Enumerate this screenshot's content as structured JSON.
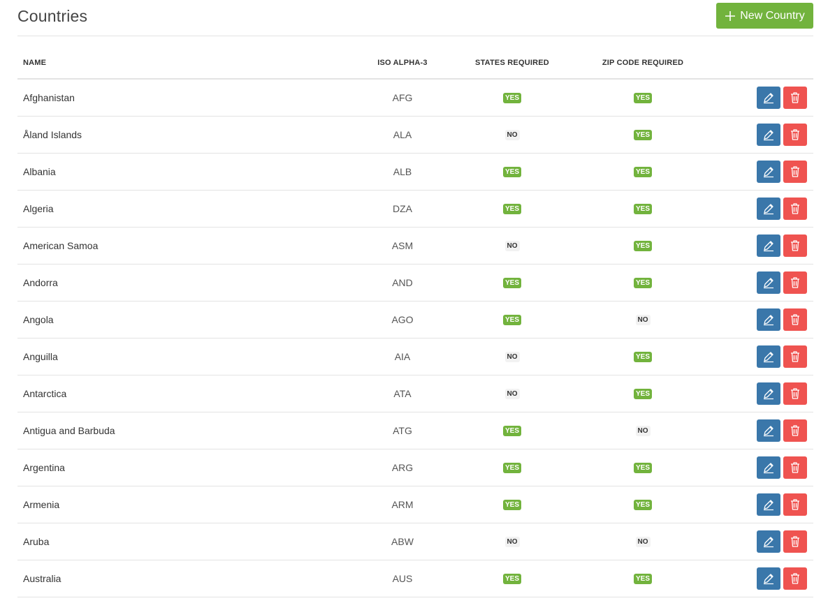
{
  "header": {
    "title": "Countries",
    "new_button_label": "New Country",
    "new_button_icon": "plus-icon"
  },
  "colors": {
    "accent_green": "#72b33d",
    "edit_blue": "#3a77aa",
    "delete_red": "#ef5350"
  },
  "table": {
    "columns": {
      "name": "NAME",
      "iso": "ISO ALPHA-3",
      "states": "STATES REQUIRED",
      "zip": "ZIP CODE REQUIRED"
    },
    "row_actions": {
      "edit_icon": "pencil-icon",
      "delete_icon": "trash-icon"
    },
    "rows": [
      {
        "name": "Afghanistan",
        "iso": "AFG",
        "states": "YES",
        "zip": "YES"
      },
      {
        "name": "Åland Islands",
        "iso": "ALA",
        "states": "NO",
        "zip": "YES"
      },
      {
        "name": "Albania",
        "iso": "ALB",
        "states": "YES",
        "zip": "YES"
      },
      {
        "name": "Algeria",
        "iso": "DZA",
        "states": "YES",
        "zip": "YES"
      },
      {
        "name": "American Samoa",
        "iso": "ASM",
        "states": "NO",
        "zip": "YES"
      },
      {
        "name": "Andorra",
        "iso": "AND",
        "states": "YES",
        "zip": "YES"
      },
      {
        "name": "Angola",
        "iso": "AGO",
        "states": "YES",
        "zip": "NO"
      },
      {
        "name": "Anguilla",
        "iso": "AIA",
        "states": "NO",
        "zip": "YES"
      },
      {
        "name": "Antarctica",
        "iso": "ATA",
        "states": "NO",
        "zip": "YES"
      },
      {
        "name": "Antigua and Barbuda",
        "iso": "ATG",
        "states": "YES",
        "zip": "NO"
      },
      {
        "name": "Argentina",
        "iso": "ARG",
        "states": "YES",
        "zip": "YES"
      },
      {
        "name": "Armenia",
        "iso": "ARM",
        "states": "YES",
        "zip": "YES"
      },
      {
        "name": "Aruba",
        "iso": "ABW",
        "states": "NO",
        "zip": "NO"
      },
      {
        "name": "Australia",
        "iso": "AUS",
        "states": "YES",
        "zip": "YES"
      }
    ]
  }
}
